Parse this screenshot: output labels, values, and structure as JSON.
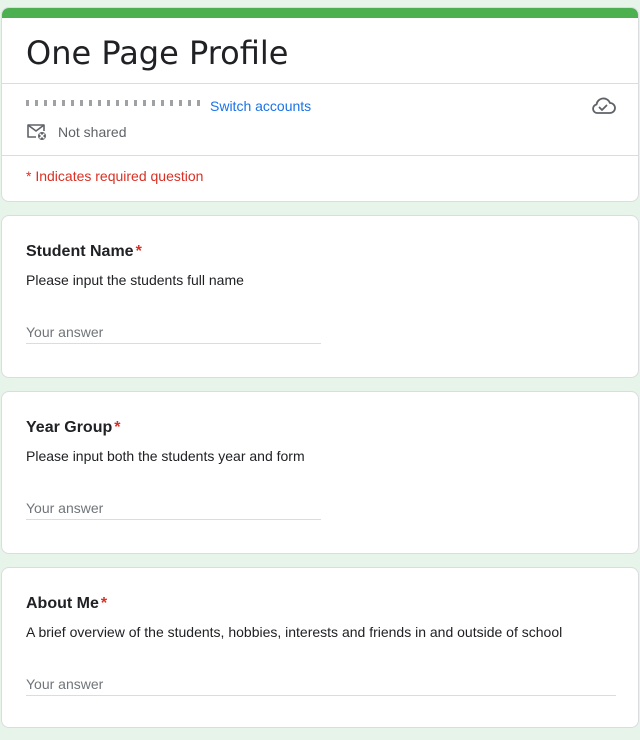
{
  "form": {
    "title": "One Page Profile",
    "switch_accounts": "Switch accounts",
    "sharing_status": "Not shared",
    "required_note": "* Indicates required question"
  },
  "icons": {
    "cloud": "cloud-check-icon",
    "mail": "mail-not-shared-icon"
  },
  "colors": {
    "accent": "#4caf50",
    "background": "#e6f4ea",
    "link": "#1a73e8",
    "required": "#d93025"
  },
  "questions": [
    {
      "title": "Student Name",
      "required_marker": "*",
      "description": "Please input the students full name",
      "placeholder": "Your answer",
      "value": ""
    },
    {
      "title": "Year Group",
      "required_marker": "*",
      "description": "Please input both the students year and form",
      "placeholder": "Your answer",
      "value": ""
    },
    {
      "title": "About Me",
      "required_marker": "*",
      "description": "A brief overview of the students, hobbies, interests and friends in and outside of school",
      "placeholder": "Your answer",
      "value": ""
    }
  ]
}
